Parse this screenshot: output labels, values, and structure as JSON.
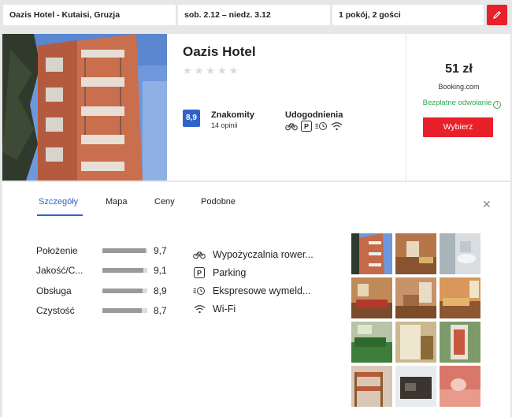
{
  "search": {
    "destination": "Oazis Hotel - Kutaisi, Gruzja",
    "dates": "sob. 2.12  –  niedz. 3.12",
    "guests": "1 pokój, 2 gości"
  },
  "hotel": {
    "name": "Oazis Hotel",
    "stars": "★★★★★",
    "score": "8,9",
    "score_label": "Znakomity",
    "reviews": "14 opinii",
    "amenities_label": "Udogodnienia",
    "amenity_icons": [
      "bicycle-icon",
      "parking-icon",
      "express-checkout-icon",
      "wifi-icon"
    ]
  },
  "offer": {
    "price": "51 zł",
    "provider": "Booking.com",
    "cancellation": "Bezpłatne odwołanie",
    "select_label": "Wybierz"
  },
  "tabs": [
    "Szczegóły",
    "Mapa",
    "Ceny",
    "Podobne"
  ],
  "active_tab": "Szczegóły",
  "ratings": [
    {
      "name": "Położenie",
      "value": "9,7",
      "fraction": 0.97
    },
    {
      "name": "Jakość/C...",
      "value": "9,1",
      "fraction": 0.91
    },
    {
      "name": "Obsługa",
      "value": "8,9",
      "fraction": 0.89
    },
    {
      "name": "Czystość",
      "value": "8,7",
      "fraction": 0.87
    }
  ],
  "facilities": [
    {
      "icon": "bicycle-icon",
      "label": "Wypożyczalnia rower..."
    },
    {
      "icon": "parking-icon",
      "label": "Parking"
    },
    {
      "icon": "express-checkout-icon",
      "label": "Ekspresowe wymeld..."
    },
    {
      "icon": "wifi-icon",
      "label": "Wi-Fi"
    }
  ],
  "colors": {
    "accent_red": "#e8202a",
    "score_blue": "#2e64c8",
    "cancel_green": "#2fa84f"
  }
}
